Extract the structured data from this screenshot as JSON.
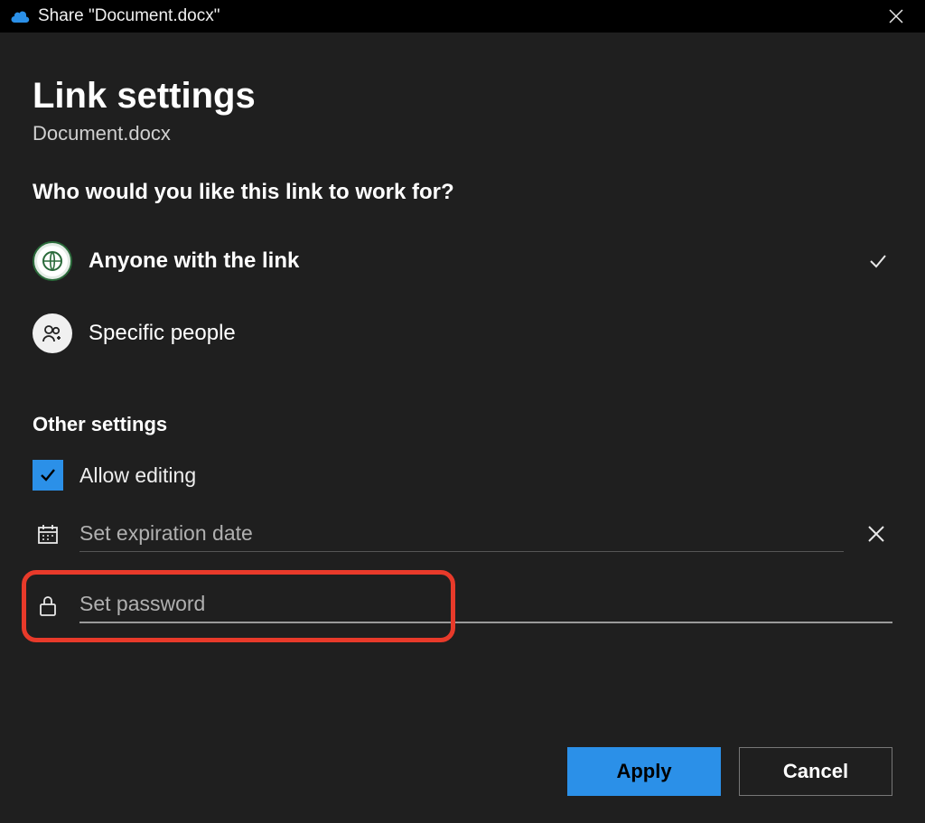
{
  "titlebar": {
    "label": "Share \"Document.docx\""
  },
  "page": {
    "title": "Link settings",
    "filename": "Document.docx",
    "question": "Who would you like this link to work for?"
  },
  "access_options": {
    "anyone": {
      "label": "Anyone with the link",
      "selected": true
    },
    "specific": {
      "label": "Specific people",
      "selected": false
    }
  },
  "other_settings": {
    "title": "Other settings",
    "allow_editing": {
      "label": "Allow editing",
      "checked": true
    },
    "expiration": {
      "placeholder": "Set expiration date",
      "value": ""
    },
    "password": {
      "placeholder": "Set password",
      "value": ""
    }
  },
  "footer": {
    "apply": "Apply",
    "cancel": "Cancel"
  },
  "colors": {
    "accent": "#2b90e8",
    "highlight": "#e83a2a"
  }
}
